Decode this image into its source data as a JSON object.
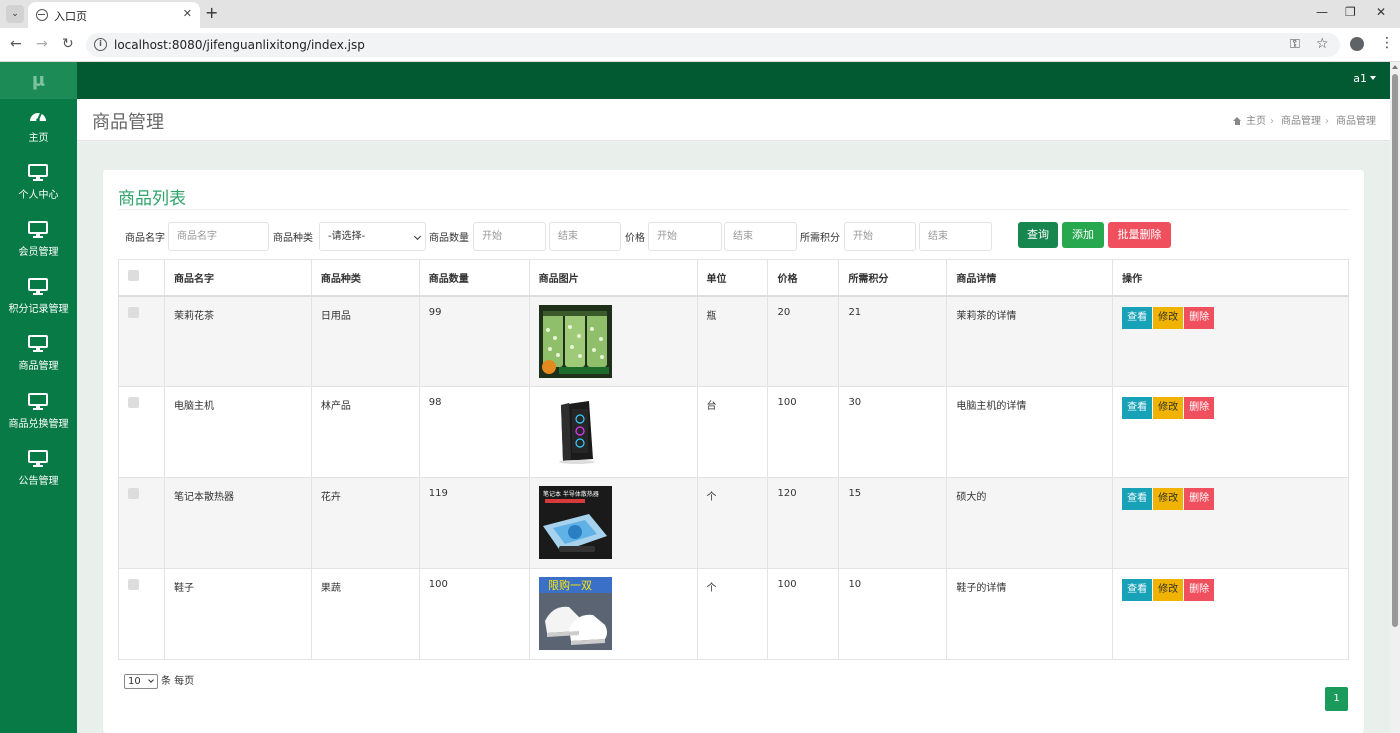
{
  "browser": {
    "tab_title": "入口页",
    "url": "localhost:8080/jifenguanlixitong/index.jsp"
  },
  "sidebar": {
    "logo": "μ",
    "items": [
      {
        "label": "主页",
        "icon": "dashboard-icon"
      },
      {
        "label": "个人中心",
        "icon": "monitor-icon"
      },
      {
        "label": "会员管理",
        "icon": "monitor-icon"
      },
      {
        "label": "积分记录管理",
        "icon": "monitor-icon"
      },
      {
        "label": "商品管理",
        "icon": "monitor-icon"
      },
      {
        "label": "商品兑换管理",
        "icon": "monitor-icon"
      },
      {
        "label": "公告管理",
        "icon": "monitor-icon"
      }
    ]
  },
  "topbar": {
    "user": "a1"
  },
  "header": {
    "title": "商品管理",
    "breadcrumb": [
      "主页",
      "商品管理",
      "商品管理"
    ]
  },
  "card": {
    "title": "商品列表"
  },
  "search": {
    "name_label": "商品名字",
    "name_placeholder": "商品名字",
    "type_label": "商品种类",
    "type_selected": "-请选择-",
    "qty_label": "商品数量",
    "price_label": "价格",
    "points_label": "所需积分",
    "start_placeholder": "开始",
    "end_placeholder": "结束",
    "query_label": "查询",
    "add_label": "添加",
    "batch_delete_label": "批量删除"
  },
  "table": {
    "headers": [
      "商品名字",
      "商品种类",
      "商品数量",
      "商品图片",
      "单位",
      "价格",
      "所需积分",
      "商品详情",
      "操作"
    ],
    "rows": [
      {
        "name": "茉莉花茶",
        "type": "日用品",
        "qty": "99",
        "image": "tea-jars",
        "unit": "瓶",
        "price": "20",
        "points": "21",
        "detail": "茉莉茶的详情"
      },
      {
        "name": "电脑主机",
        "type": "林产品",
        "qty": "98",
        "image": "pc-case",
        "unit": "台",
        "price": "100",
        "points": "30",
        "detail": "电脑主机的详情"
      },
      {
        "name": "笔记本散热器",
        "type": "花卉",
        "qty": "119",
        "image": "laptop-cooler",
        "unit": "个",
        "price": "120",
        "points": "15",
        "detail": "硕大的",
        "image_text": "笔记本 半导体散热器"
      },
      {
        "name": "鞋子",
        "type": "果蔬",
        "qty": "100",
        "image": "white-shoes",
        "unit": "个",
        "price": "100",
        "points": "10",
        "detail": "鞋子的详情",
        "image_text": "限购一双"
      }
    ],
    "actions": {
      "view": "查看",
      "edit": "修改",
      "delete": "删除"
    }
  },
  "pager": {
    "page_size": "10",
    "per_page_text": "条 每页",
    "current_page": "1"
  },
  "colors": {
    "sidebar": "#087a46",
    "topbar": "#015a32",
    "accent": "#2fa36a",
    "view": "#17a2b8",
    "edit": "#f0b400",
    "delete": "#f04f5e"
  }
}
